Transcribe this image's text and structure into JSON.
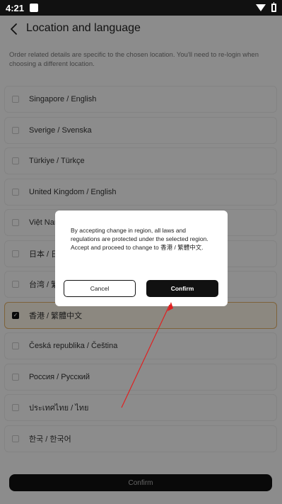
{
  "status_bar": {
    "time": "4:21"
  },
  "header": {
    "title": "Location and language"
  },
  "notice": "Order related details are specific to the chosen location. You'll need to re-login when choosing a different location.",
  "locations": [
    {
      "label": "Singapore / English",
      "selected": false
    },
    {
      "label": "Sverige / Svenska",
      "selected": false
    },
    {
      "label": "Türkiye / Türkçe",
      "selected": false
    },
    {
      "label": "United Kingdom / English",
      "selected": false
    },
    {
      "label": "Việt Nam",
      "selected": false
    },
    {
      "label": "日本 / 日",
      "selected": false
    },
    {
      "label": "台湾 / 繁",
      "selected": false
    },
    {
      "label": "香港 / 繁體中文",
      "selected": true
    },
    {
      "label": "Česká republika / Čeština",
      "selected": false
    },
    {
      "label": "Россия / Русский",
      "selected": false
    },
    {
      "label": "ประเทศไทย / ไทย",
      "selected": false
    },
    {
      "label": "한국 / 한국어",
      "selected": false
    }
  ],
  "footer": {
    "confirm_label": "Confirm"
  },
  "dialog": {
    "message": "By accepting change in region, all laws and regulations are protected under the selected region. Accept and proceed to change to 香港 / 繁體中文.",
    "cancel_label": "Cancel",
    "confirm_label": "Confirm"
  },
  "colors": {
    "selected_border": "#e6b26a",
    "annotation_arrow": "#e02020"
  }
}
